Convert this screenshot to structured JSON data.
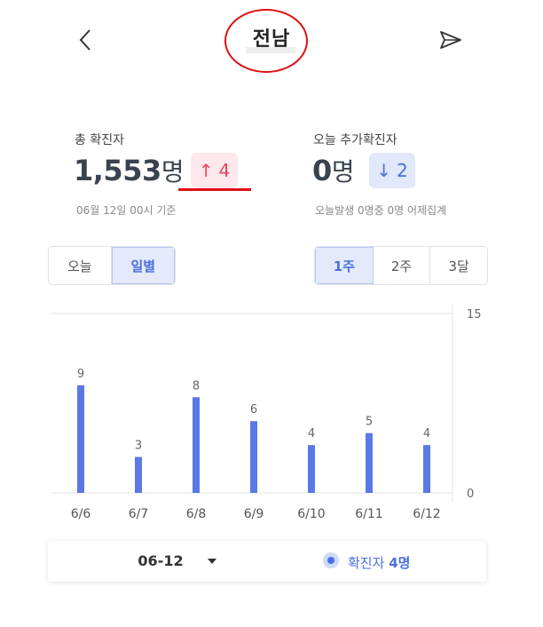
{
  "header": {
    "title": "전남"
  },
  "total": {
    "label": "총 확진자",
    "value": "1,553",
    "unit": "명",
    "delta_arrow": "↑",
    "delta": "4",
    "note": "06월 12일 00시 기준"
  },
  "today": {
    "label": "오늘 추가확진자",
    "value": "0",
    "unit": "명",
    "delta_arrow": "↓",
    "delta": "2",
    "note": "오늘발생 0명중 0명 어제집계"
  },
  "view_toggle": {
    "options": [
      "오늘",
      "일별"
    ],
    "selected": "일별"
  },
  "range_toggle": {
    "options": [
      "1주",
      "2주",
      "3달"
    ],
    "selected": "1주"
  },
  "chart_data": {
    "type": "bar",
    "categories": [
      "6/6",
      "6/7",
      "6/8",
      "6/9",
      "6/10",
      "6/11",
      "6/12"
    ],
    "values": [
      9,
      3,
      8,
      6,
      4,
      5,
      4
    ],
    "ylim": [
      0,
      15
    ],
    "y_ticks": [
      0,
      15
    ],
    "y_axis_position": "right",
    "data_labels": true,
    "bar_color": "#5b78e8"
  },
  "footer": {
    "date": "06-12",
    "legend_label": "확진자",
    "legend_value": "4명"
  },
  "colors": {
    "accent": "#4a6fe0",
    "up": "#e8455f",
    "annotation": "#e01010"
  }
}
